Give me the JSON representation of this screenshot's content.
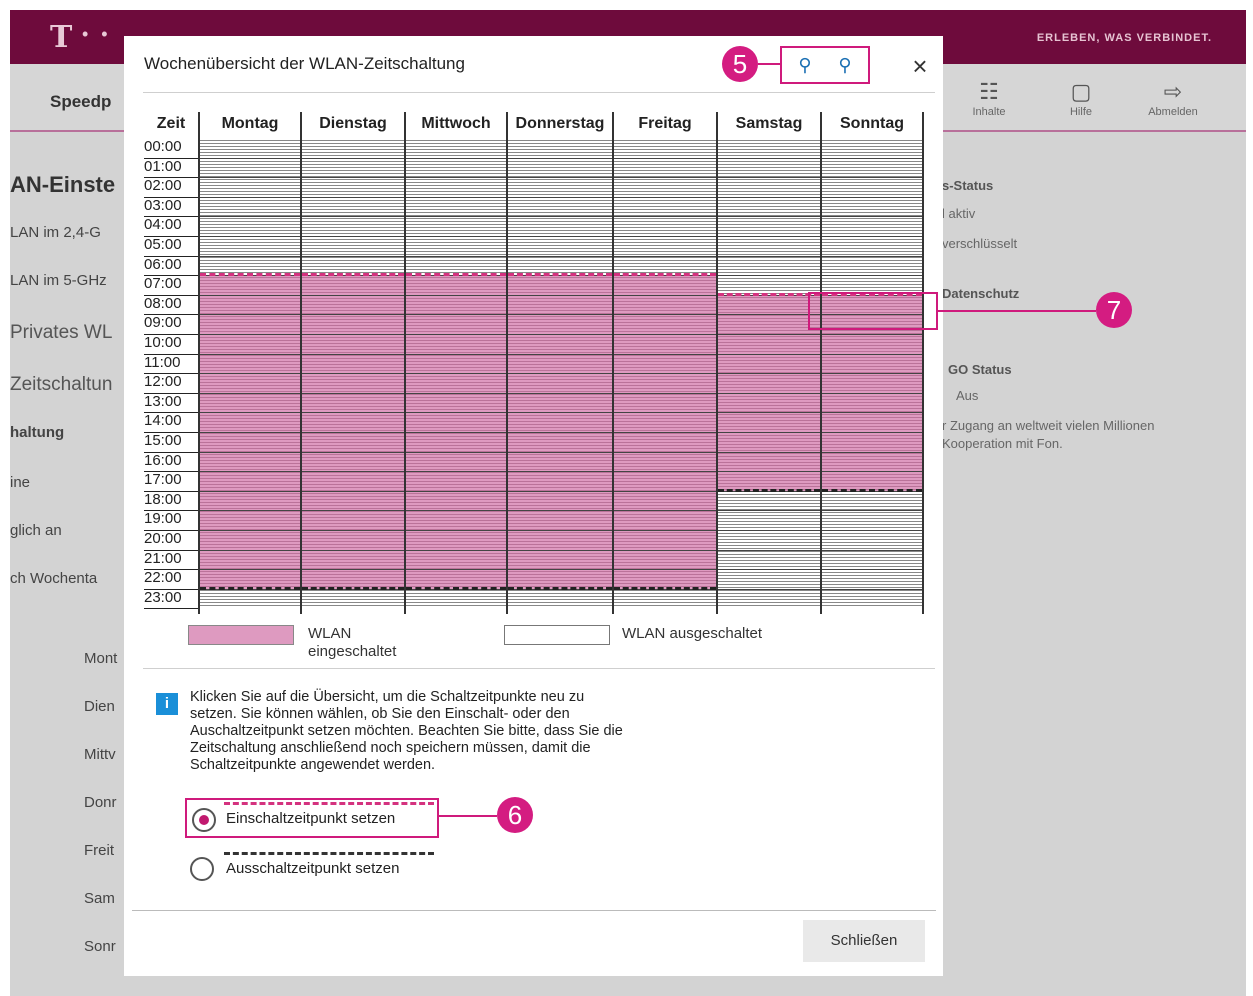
{
  "app": {
    "slogan": "ERLEBEN, WAS VERBINDET.",
    "nav_title": "Speedp",
    "nav_items": [
      {
        "label": "Inhalte",
        "icon": "sitemap-icon"
      },
      {
        "label": "Hilfe",
        "icon": "help-icon"
      },
      {
        "label": "Abmelden",
        "icon": "logout-icon"
      }
    ],
    "bg_left": [
      "AN-Einste",
      "LAN im 2,4-G",
      "LAN im 5-GHz",
      "Privates WL",
      "Zeitschaltun",
      "haltung",
      "ine",
      "glich an",
      "ch Wochenta",
      "Mont",
      "Dien",
      "Mittv",
      "Donr",
      "Freit",
      "Sam",
      "Sonr"
    ],
    "bg_right": [
      "s-Status",
      "l aktiv",
      "verschlüsselt",
      "Datenschutz",
      "GO Status",
      "Aus",
      "r Zugang an weltweit vielen Millionen",
      "Kooperation mit Fon."
    ]
  },
  "dialog": {
    "title": "Wochenübersicht der WLAN-Zeitschaltung",
    "zoom_in_icon": "zoom-in-icon",
    "zoom_out_icon": "zoom-out-icon",
    "close_icon": "close-icon",
    "time_header": "Zeit",
    "days": [
      "Montag",
      "Dienstag",
      "Mittwoch",
      "Donnerstag",
      "Freitag",
      "Samstag",
      "Sonntag"
    ],
    "times": [
      "00:00",
      "01:00",
      "02:00",
      "03:00",
      "04:00",
      "05:00",
      "06:00",
      "07:00",
      "08:00",
      "09:00",
      "10:00",
      "11:00",
      "12:00",
      "13:00",
      "14:00",
      "15:00",
      "16:00",
      "17:00",
      "18:00",
      "19:00",
      "20:00",
      "21:00",
      "22:00",
      "23:00"
    ],
    "schedule": [
      {
        "day": "Montag",
        "on": "07:00",
        "off": "23:00"
      },
      {
        "day": "Dienstag",
        "on": "07:00",
        "off": "23:00"
      },
      {
        "day": "Mittwoch",
        "on": "07:00",
        "off": "23:00"
      },
      {
        "day": "Donnerstag",
        "on": "07:00",
        "off": "23:00"
      },
      {
        "day": "Freitag",
        "on": "07:00",
        "off": "23:00"
      },
      {
        "day": "Samstag",
        "on": "08:00",
        "off": "18:00"
      },
      {
        "day": "Sonntag",
        "on": "08:00",
        "off": "18:00"
      }
    ],
    "legend_on": "WLAN eingeschaltet",
    "legend_off": "WLAN ausgeschaltet",
    "info": "Klicken Sie auf die Übersicht, um die Schaltzeitpunkte neu zu setzen. Sie können wählen, ob Sie den Einschalt- oder den Auschaltzeitpunkt setzen möchten. Beachten Sie bitte, dass Sie die Zeitschaltung anschließend noch speichern müssen, damit die Schaltzeitpunkte angewendet werden.",
    "radio_on": "Einschaltzeitpunkt setzen",
    "radio_off": "Ausschaltzeitpunkt setzen",
    "radio_selected": "on",
    "close_button": "Schließen"
  },
  "annotations": [
    "5",
    "6",
    "7"
  ],
  "colors": {
    "brand": "#6e0b3c",
    "accent": "#d41c81",
    "wlan_on": "#de9ac0",
    "on_marker": "#d4327f",
    "off_marker": "#222222",
    "info": "#1a8fd8"
  }
}
